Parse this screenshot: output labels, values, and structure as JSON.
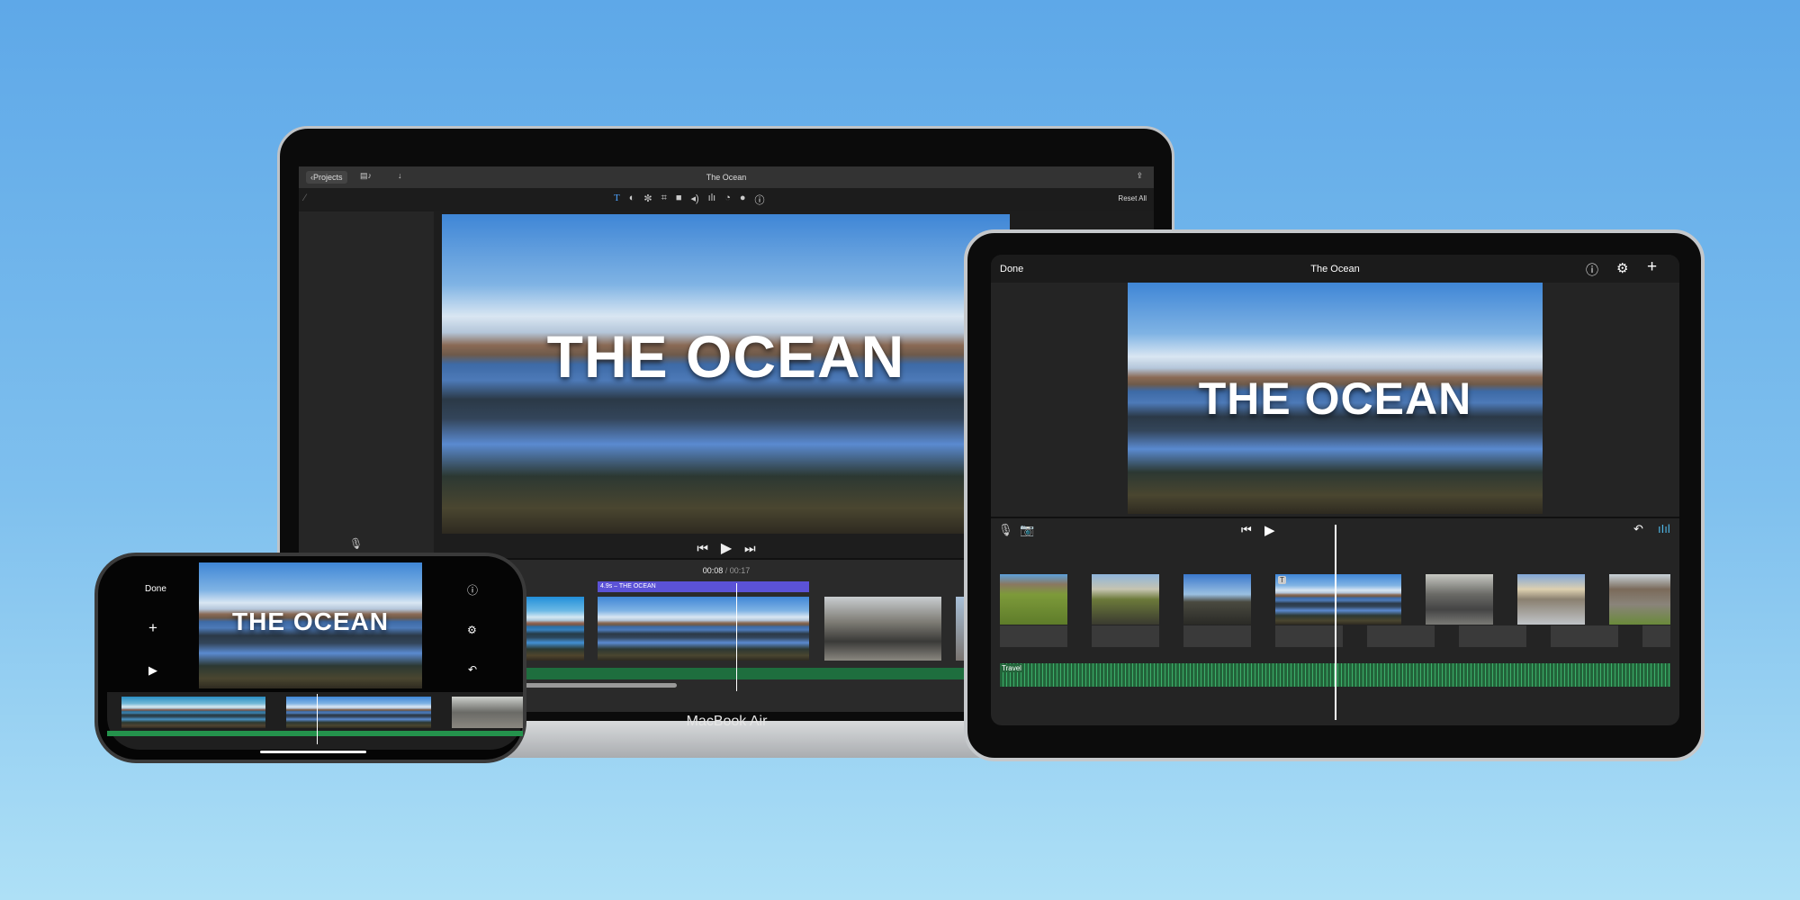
{
  "macbook": {
    "top_bar": {
      "back_label": "Projects",
      "title": "The Ocean",
      "icons": [
        "chevron-left-icon",
        "media-library-icon",
        "download-icon",
        "share-icon"
      ]
    },
    "toolbar": {
      "icons": [
        "magic-wand-icon",
        "title-icon",
        "color-balance-icon",
        "color-correction-icon",
        "crop-icon",
        "stabilization-icon",
        "volume-icon",
        "noise-reduction-icon",
        "speed-icon",
        "filter-icon",
        "info-icon"
      ],
      "reset_label": "Reset All"
    },
    "viewer": {
      "title_text": "THE OCEAN"
    },
    "transport": {
      "icons": [
        "microphone-icon",
        "skip-back-icon",
        "play-icon",
        "skip-forward-icon"
      ]
    },
    "timecode": {
      "current": "00:08",
      "separator": "/",
      "total": "00:17"
    },
    "timeline": {
      "title_clip_label": "4.9s – THE OCEAN",
      "accent": "#5b52d6",
      "audio_color": "#1e6e3e"
    },
    "device_label": "MacBook Air"
  },
  "ipad": {
    "top_bar": {
      "done_label": "Done",
      "title": "The Ocean",
      "icons": [
        "help-icon",
        "settings-icon",
        "add-icon"
      ]
    },
    "viewer": {
      "title_text": "THE OCEAN"
    },
    "controls": {
      "icons": [
        "microphone-icon",
        "camera-icon",
        "skip-back-icon",
        "play-icon",
        "undo-icon",
        "audio-waveform-icon"
      ]
    },
    "timeline": {
      "audio_label": "Travel",
      "audio_color": "#23643a"
    }
  },
  "iphone": {
    "done_label": "Done",
    "viewer": {
      "title_text": "THE OCEAN"
    },
    "icons": [
      "add-icon",
      "play-icon",
      "help-icon",
      "settings-icon",
      "undo-icon"
    ]
  }
}
